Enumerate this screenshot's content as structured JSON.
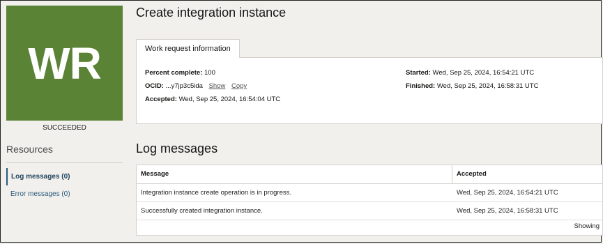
{
  "badge": {
    "initials": "WR",
    "color": "#5b8336",
    "state": "SUCCEEDED"
  },
  "resources": {
    "title": "Resources",
    "items": [
      {
        "label": "Log messages (0)",
        "active": true
      },
      {
        "label": "Error messages (0)",
        "active": false
      }
    ]
  },
  "page_title": "Create integration instance",
  "tab_label": "Work request information",
  "info": {
    "percent_label": "Percent complete:",
    "percent_value": "100",
    "ocid_label": "OCID:",
    "ocid_value": "...y7jp3c5ida",
    "show": "Show",
    "copy": "Copy",
    "accepted_label": "Accepted:",
    "accepted_value": "Wed, Sep 25, 2024, 16:54:04 UTC",
    "started_label": "Started:",
    "started_value": "Wed, Sep 25, 2024, 16:54:21 UTC",
    "finished_label": "Finished:",
    "finished_value": "Wed, Sep 25, 2024, 16:58:31 UTC"
  },
  "log": {
    "title": "Log messages",
    "columns": [
      "Message",
      "Accepted"
    ],
    "rows": [
      [
        "Integration instance create operation is in progress.",
        "Wed, Sep 25, 2024, 16:54:21 UTC"
      ],
      [
        "Successfully created integration instance.",
        "Wed, Sep 25, 2024, 16:58:31 UTC"
      ]
    ],
    "footer": "Showing"
  }
}
